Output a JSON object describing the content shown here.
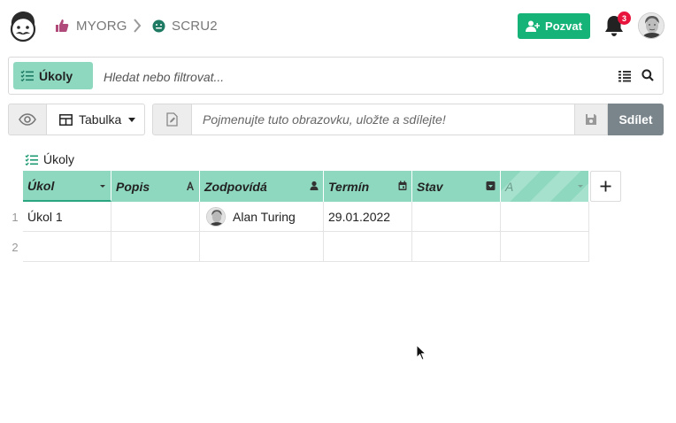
{
  "header": {
    "org_name": "MYORG",
    "project_name": "SCRU2",
    "invite_label": "Pozvat",
    "notification_count": "3"
  },
  "search": {
    "section_label": "Úkoly",
    "placeholder": "Hledat nebo filtrovat..."
  },
  "viewbar": {
    "view_label": "Tabulka",
    "name_placeholder": "Pojmenujte tuto obrazovku, uložte a sdílejte!",
    "share_label": "Sdílet"
  },
  "table": {
    "title": "Úkoly",
    "columns": [
      {
        "label": "Úkol",
        "type_icon": "caret-down-icon"
      },
      {
        "label": "Popis",
        "type_icon": "text-type-icon"
      },
      {
        "label": "Zodpovídá",
        "type_icon": "person-icon"
      },
      {
        "label": "Termín",
        "type_icon": "calendar-icon"
      },
      {
        "label": "Stav",
        "type_icon": "dropdown-icon"
      },
      {
        "label": "A",
        "type_icon": "caret-down-icon"
      }
    ],
    "rows": [
      {
        "num": "1",
        "cells": [
          "Úkol 1",
          "",
          "Alan Turing",
          "29.01.2022",
          "",
          ""
        ]
      },
      {
        "num": "2",
        "cells": [
          "",
          "",
          "",
          "",
          "",
          ""
        ]
      }
    ]
  },
  "colors": {
    "accent": "#16b378",
    "header_fill": "#8ed8c0",
    "share": "#7a858b",
    "badge": "#e8143c"
  }
}
